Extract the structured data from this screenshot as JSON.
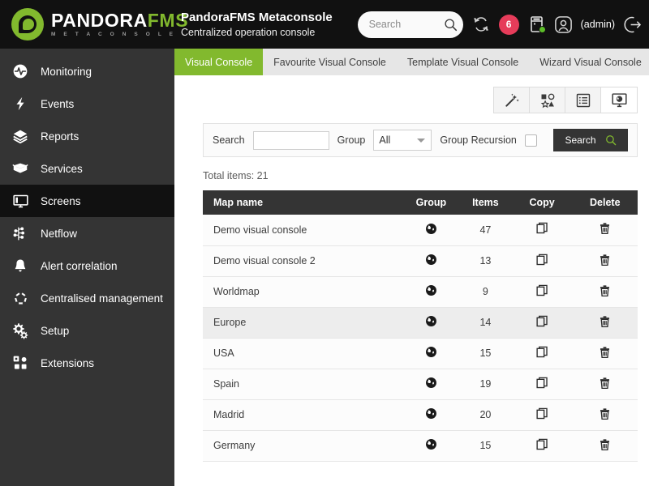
{
  "brand": {
    "name_white": "PANDORA",
    "name_green": "FMS",
    "subtitle": "M E T A C O N S O L E",
    "logo_icon": "pandora-logo-icon"
  },
  "header": {
    "title": "PandoraFMS Metaconsole",
    "subtitle": "Centralized operation console",
    "search": {
      "value": "",
      "placeholder": "Search",
      "icon": "search-icon"
    },
    "refresh_icon": "refresh-sync-icon",
    "alert_badge": "6",
    "server_icon": "server-status-icon",
    "server_status_color": "#5cbd28",
    "user_icon": "user-avatar-icon",
    "user_label": "(admin)",
    "logout_icon": "logout-icon",
    "background": "#111111"
  },
  "sidebar": {
    "background": "#343434",
    "active_background": "#111111",
    "items": [
      {
        "label": "Monitoring",
        "icon": "monitoring-pulse-icon",
        "active": false
      },
      {
        "label": "Events",
        "icon": "lightning-bolt-icon",
        "active": false
      },
      {
        "label": "Reports",
        "icon": "layers-icon",
        "active": false
      },
      {
        "label": "Services",
        "icon": "open-box-icon",
        "active": false
      },
      {
        "label": "Screens",
        "icon": "monitor-screen-icon",
        "active": true
      },
      {
        "label": "Netflow",
        "icon": "netflow-branch-icon",
        "active": false
      },
      {
        "label": "Alert correlation",
        "icon": "bell-icon",
        "active": false
      },
      {
        "label": "Centralised management",
        "icon": "pentagon-nodes-icon",
        "active": false
      },
      {
        "label": "Setup",
        "icon": "gears-icon",
        "active": false
      },
      {
        "label": "Extensions",
        "icon": "extensions-grid-icon",
        "active": false
      }
    ]
  },
  "tabs": {
    "active_color": "#82b92e",
    "background": "#e6e6e6",
    "items": [
      {
        "label": "Visual Console",
        "active": true
      },
      {
        "label": "Favourite Visual Console",
        "active": false
      },
      {
        "label": "Template Visual Console",
        "active": false
      },
      {
        "label": "Wizard Visual Console",
        "active": false
      }
    ]
  },
  "toolbar": {
    "buttons": [
      {
        "icon": "magic-wand-icon",
        "active": false
      },
      {
        "icon": "shapes-icon",
        "active": false
      },
      {
        "icon": "list-view-icon",
        "active": false
      },
      {
        "icon": "visual-console-monitor-icon",
        "active": true
      }
    ]
  },
  "filter": {
    "search_label": "Search",
    "search_value": "",
    "search_placeholder": "",
    "group_label": "Group",
    "group_value": "All",
    "group_options": [
      "All"
    ],
    "recursion_label": "Group Recursion",
    "recursion_checked": false,
    "button_label": "Search",
    "button_icon": "search-icon",
    "button_background": "#343434",
    "button_icon_color": "#82b92e"
  },
  "table": {
    "total_items_text": "Total items: 21",
    "columns": [
      "Map name",
      "Group",
      "Items",
      "Copy",
      "Delete"
    ],
    "group_icon": "globe-icon",
    "copy_icon": "copy-icon",
    "delete_icon": "trash-icon",
    "rows": [
      {
        "name": "Demo visual console",
        "items": "47",
        "highlighted": false
      },
      {
        "name": "Demo visual console 2",
        "items": "13",
        "highlighted": false
      },
      {
        "name": "Worldmap",
        "items": "9",
        "highlighted": false
      },
      {
        "name": "Europe",
        "items": "14",
        "highlighted": true
      },
      {
        "name": "USA",
        "items": "15",
        "highlighted": false
      },
      {
        "name": "Spain",
        "items": "19",
        "highlighted": false
      },
      {
        "name": "Madrid",
        "items": "20",
        "highlighted": false
      },
      {
        "name": "Germany",
        "items": "15",
        "highlighted": false
      }
    ]
  }
}
